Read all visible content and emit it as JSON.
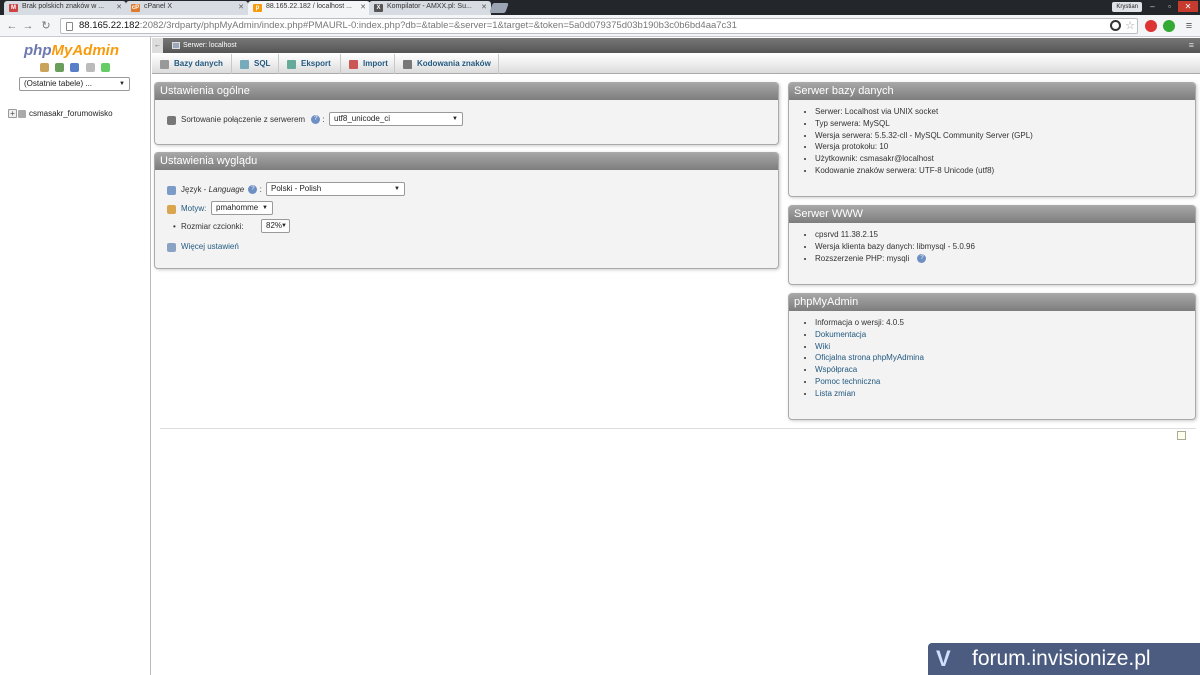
{
  "browser": {
    "tabs": [
      {
        "label": "Brak polskich znaków w ...",
        "icon": "gmail-icon",
        "color": "#c44"
      },
      {
        "label": "cPanel X",
        "icon": "cpanel-icon",
        "color": "#e07b2d"
      },
      {
        "label": "88.165.22.182 / localhost ...",
        "icon": "phpmyadmin-icon",
        "color": "#f89c0e"
      },
      {
        "label": "Kompilator - AMXX.pl: Su...",
        "icon": "amxx-icon",
        "color": "#555"
      }
    ],
    "user": "Krystian",
    "url_host": "88.165.22.182",
    "url_rest": ":2082/3rdparty/phpMyAdmin/index.php#PMAURL-0:index.php?db=&table=&server=1&target=&token=5a0d079375d03b190b3c0b6bd4aa7c31"
  },
  "logo": {
    "part1": "php",
    "part2": "MyAdmin"
  },
  "nav": {
    "recent_tables": "(Ostatnie tabele) ...",
    "databases": [
      "csmasakr_forumowisko"
    ]
  },
  "breadcrumb": {
    "server": "Serwer: localhost"
  },
  "menu": [
    {
      "label": "Bazy danych",
      "icon": "database-icon"
    },
    {
      "label": "SQL",
      "icon": "sql-icon"
    },
    {
      "label": "Eksport",
      "icon": "export-icon"
    },
    {
      "label": "Import",
      "icon": "import-icon"
    },
    {
      "label": "Kodowania znaków",
      "icon": "charset-icon"
    }
  ],
  "general_settings": {
    "title": "Ustawienia ogólne",
    "collation_label": "Sortowanie połączenie z serwerem",
    "collation_value": "utf8_unicode_ci"
  },
  "appearance_settings": {
    "title": "Ustawienia wyglądu",
    "language_label": "Język",
    "language_label_en": "Language",
    "language_value": "Polski - Polish",
    "theme_label": "Motyw:",
    "theme_value": "pmahomme",
    "font_size_label": "Rozmiar czcionki:",
    "font_size_value": "82%",
    "more_settings": "Więcej ustawień"
  },
  "db_server": {
    "title": "Serwer bazy danych",
    "items": [
      "Serwer: Localhost via UNIX socket",
      "Typ serwera: MySQL",
      "Wersja serwera: 5.5.32-cll - MySQL Community Server (GPL)",
      "Wersja protokołu: 10",
      "Użytkownik: csmasakr@localhost",
      "Kodowanie znaków serwera: UTF-8 Unicode (utf8)"
    ]
  },
  "web_server": {
    "title": "Serwer WWW",
    "items": [
      "cpsrvd 11.38.2.15",
      "Wersja klienta bazy danych: libmysql - 5.0.96",
      "Rozszerzenie PHP: mysqli"
    ]
  },
  "pma_info": {
    "title": "phpMyAdmin",
    "version": "Informacja o wersji: 4.0.5",
    "links": [
      "Dokumentacja",
      "Wiki",
      "Oficjalna strona phpMyAdmina",
      "Współpraca",
      "Pomoc techniczna",
      "Lista zmian"
    ]
  },
  "watermark": "forum.invisionize.pl"
}
